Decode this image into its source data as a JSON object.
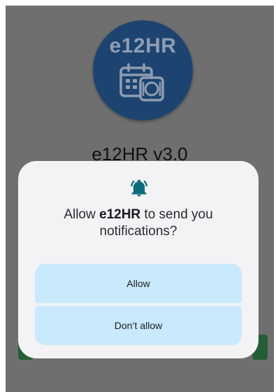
{
  "app": {
    "logo_text": "e12HR",
    "title": "e12HR v3.0"
  },
  "dialog": {
    "message_prefix": "Allow ",
    "app_name": "e12HR",
    "message_suffix": " to send you notifications?",
    "allow_label": "Allow",
    "deny_label": "Don’t allow",
    "icon": "bell-icon",
    "accent_color": "#0d6c7a"
  },
  "colors": {
    "scrim": "#6f6f6f",
    "logo_background": "#1d4470",
    "dialog_background": "#f3f3f5",
    "button_background": "#c9e9fc",
    "hidden_button": "#245e36"
  }
}
